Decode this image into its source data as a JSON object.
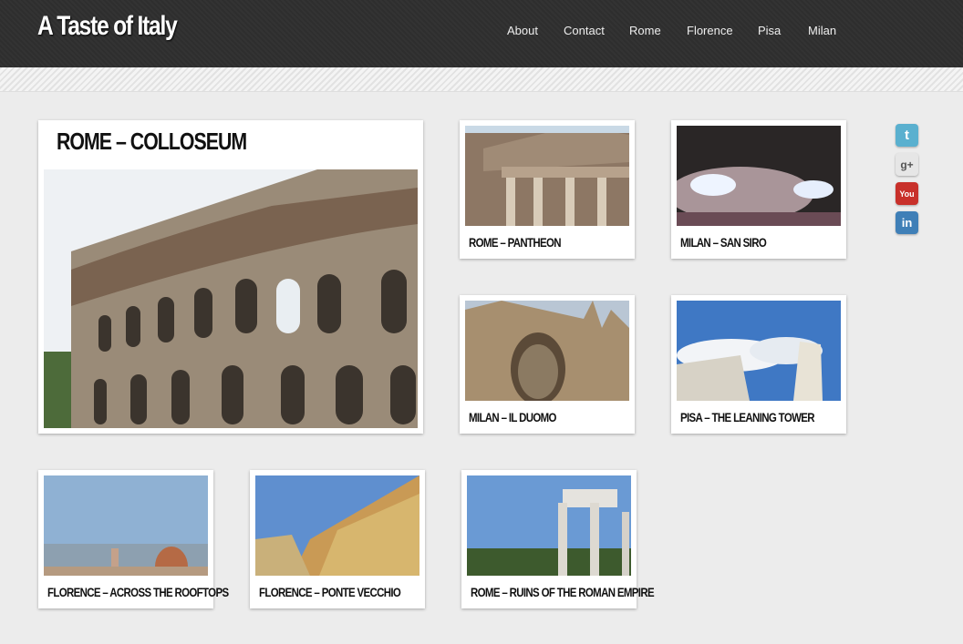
{
  "site": {
    "title": "A Taste of Italy"
  },
  "nav": [
    {
      "label": "About"
    },
    {
      "label": "Contact"
    },
    {
      "label": "Rome"
    },
    {
      "label": "Florence"
    },
    {
      "label": "Pisa"
    },
    {
      "label": "Milan"
    }
  ],
  "featured": {
    "caption": "ROME – COLLOSEUM"
  },
  "gallery": [
    {
      "caption": "ROME – PANTHEON"
    },
    {
      "caption": "MILAN – SAN SIRO"
    },
    {
      "caption": "MILAN – IL DUOMO"
    },
    {
      "caption": "PISA – THE LEANING TOWER"
    },
    {
      "caption": "FLORENCE – ACROSS THE ROOFTOPS"
    },
    {
      "caption": "FLORENCE – PONTE VECCHIO"
    },
    {
      "caption": "ROME – RUINS OF THE ROMAN EMPIRE"
    }
  ],
  "social": [
    {
      "icon": "twitter-icon",
      "glyph": "t",
      "color": "#5ab0cf"
    },
    {
      "icon": "google-plus-icon",
      "glyph": "g+",
      "color": "#e6e6e6"
    },
    {
      "icon": "youtube-icon",
      "glyph": "You",
      "color": "#c8302a"
    },
    {
      "icon": "linkedin-icon",
      "glyph": "in",
      "color": "#3f7fb7"
    }
  ]
}
